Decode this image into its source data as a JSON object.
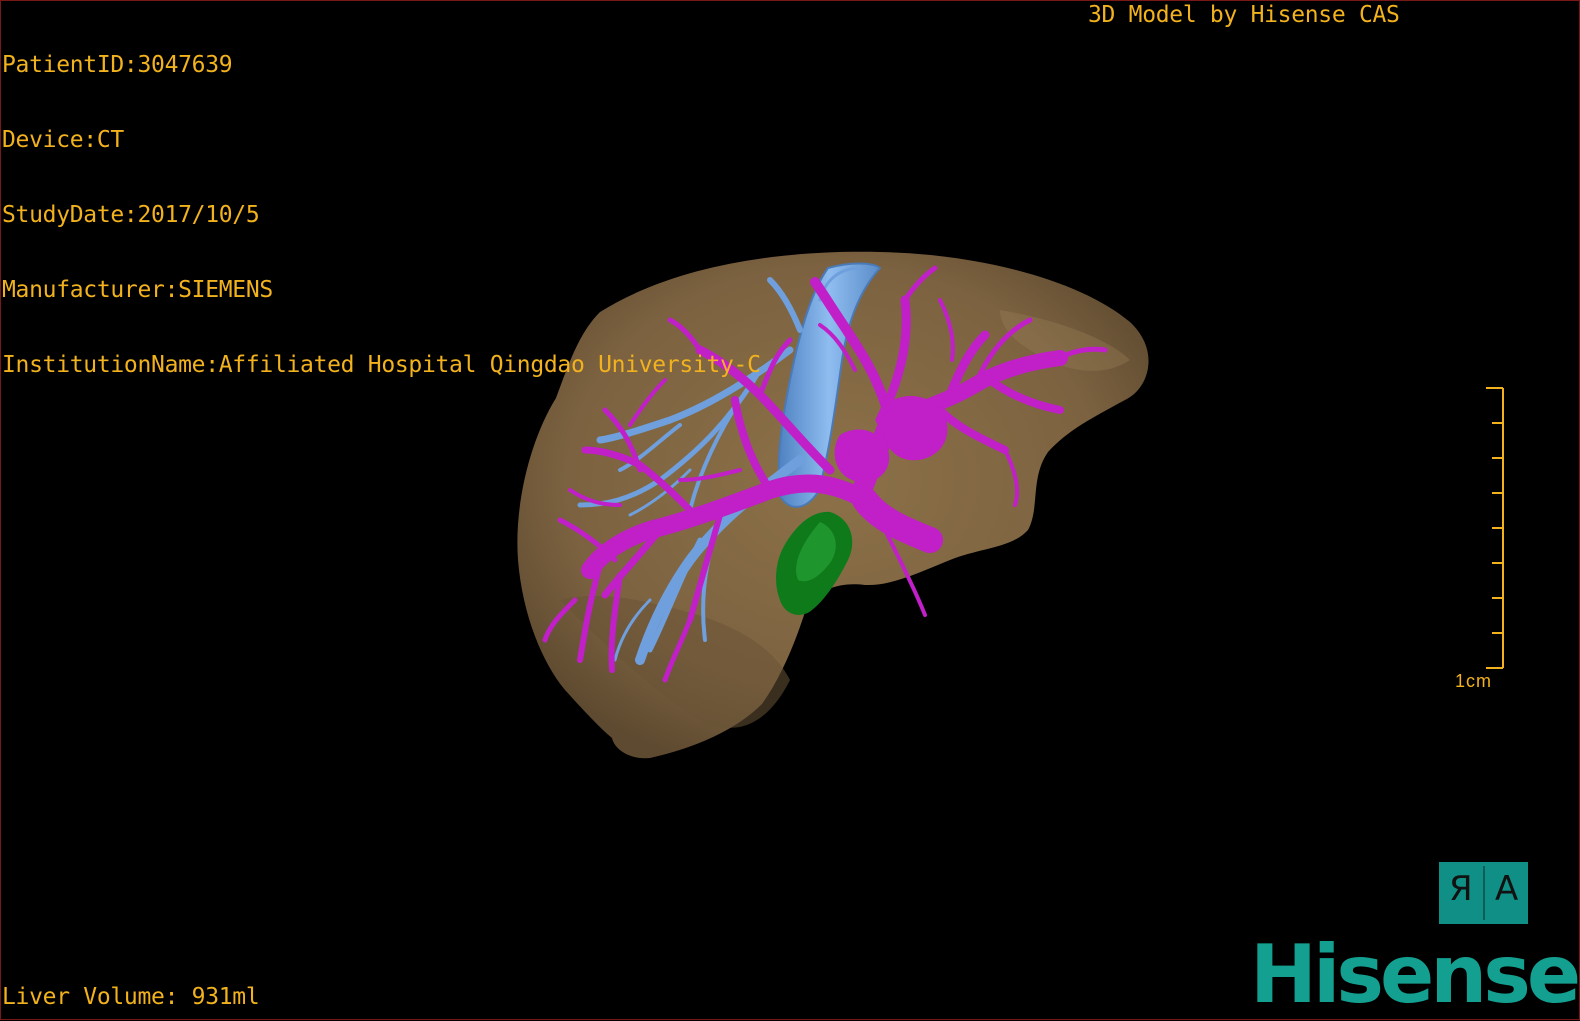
{
  "header": {
    "patient_id": "PatientID:3047639",
    "device": "Device:CT",
    "study_date": "StudyDate:2017/10/5",
    "manufacturer": "Manufacturer:SIEMENS",
    "institution": "InstitutionName:Affiliated Hospital Qingdao University-C",
    "credit": "3D Model by Hisense CAS"
  },
  "scale": {
    "label": "1cm"
  },
  "orientation": {
    "left_glyph": "Я",
    "right_glyph": "A"
  },
  "footer": {
    "volume": "Liver Volume: 931ml"
  },
  "brand": {
    "logo_text": "Hisense"
  },
  "colors": {
    "overlay_text": "#f2b21e",
    "liver": "#7f6644",
    "portal_vein": "#c11fc8",
    "hepatic_vein": "#6f9fdc",
    "gallbladder": "#0f7a1a",
    "brand": "#13a090"
  }
}
